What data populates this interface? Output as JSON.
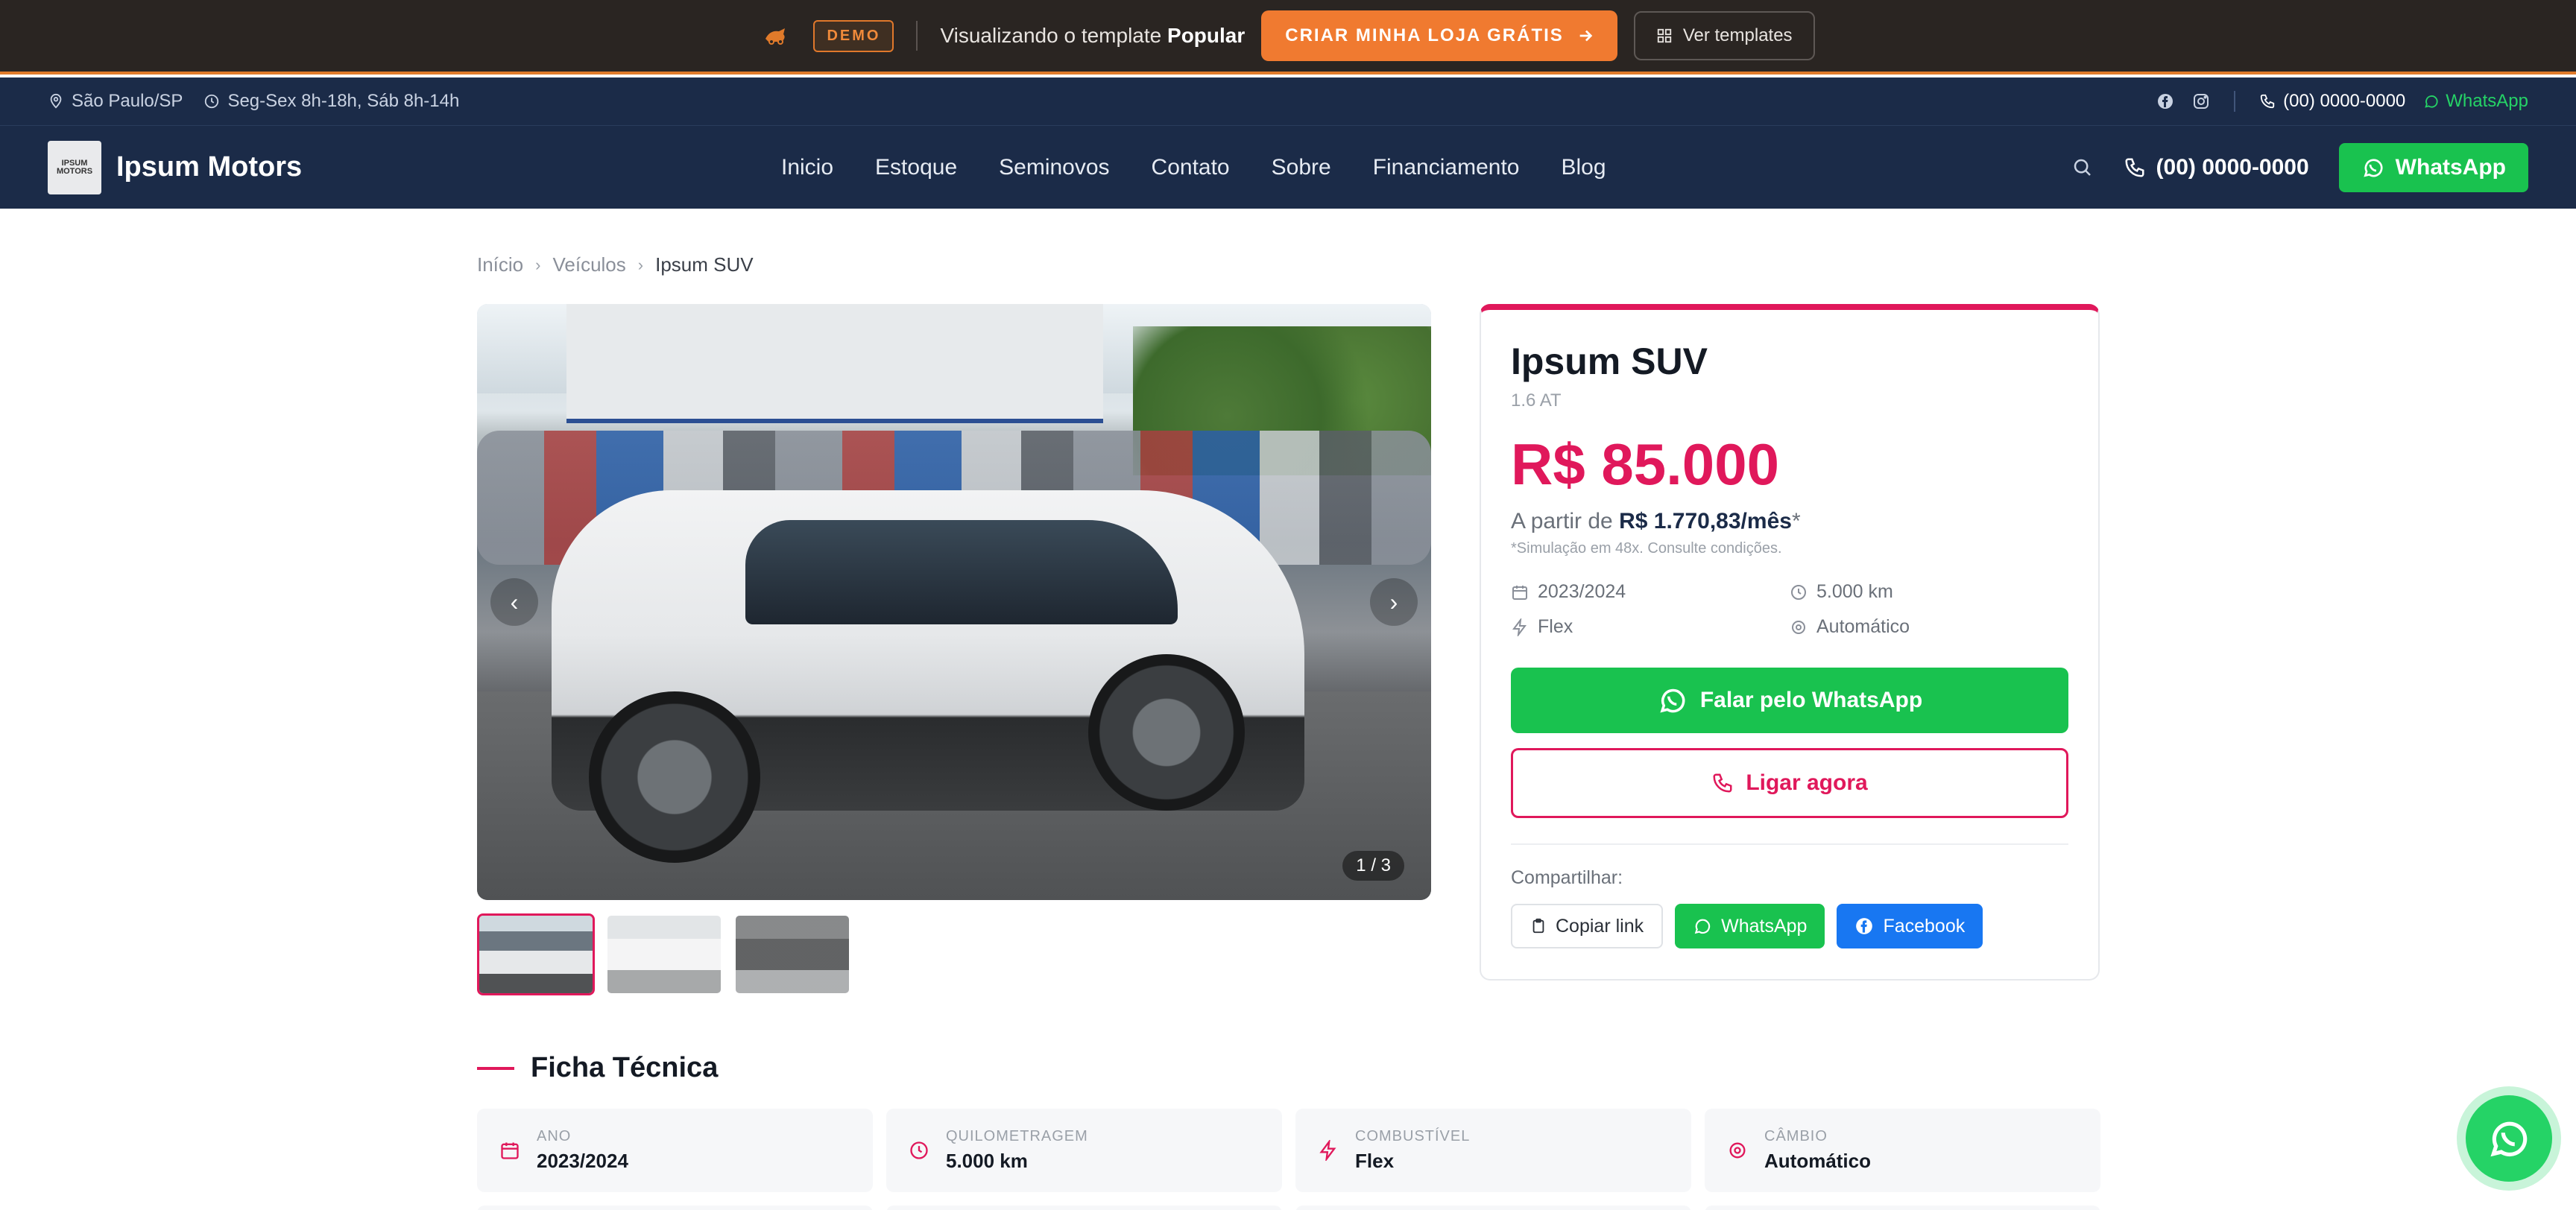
{
  "demo_bar": {
    "badge": "DEMO",
    "text_prefix": "Visualizando o template",
    "template_name": "Popular",
    "cta_label": "CRIAR MINHA LOJA GRÁTIS",
    "templates_label": "Ver templates",
    "accent_color": "#f07a30"
  },
  "info_bar": {
    "location": "São Paulo/SP",
    "hours": "Seg-Sex 8h-18h, Sáb 8h-14h",
    "phone": "(00) 0000-0000",
    "whatsapp": "WhatsApp",
    "social_icons": [
      "facebook-icon",
      "instagram-icon"
    ]
  },
  "nav": {
    "brand": "Ipsum Motors",
    "logo_text": "IPSUM MOTORS",
    "links": [
      "Inicio",
      "Estoque",
      "Seminovos",
      "Contato",
      "Sobre",
      "Financiamento",
      "Blog"
    ],
    "phone": "(00) 0000-0000",
    "whatsapp": "WhatsApp",
    "background_color": "#1b2b48"
  },
  "breadcrumb": [
    "Início",
    "Veículos",
    "Ipsum SUV"
  ],
  "gallery": {
    "counter": "1 / 3",
    "prev_icon": "chevron-left-icon",
    "next_icon": "chevron-right-icon",
    "thumbnail_count": 3,
    "active_thumbnail": 1
  },
  "card": {
    "title": "Ipsum SUV",
    "subtitle": "1.6 AT",
    "price": "R$ 85.000",
    "install_prefix": "A partir de",
    "install_value": "R$ 1.770,83/mês",
    "install_suffix": "*",
    "simulation_note": "*Simulação em 48x. Consulte condições.",
    "specs": {
      "year": "2023/2024",
      "mileage": "5.000 km",
      "fuel": "Flex",
      "transmission": "Automático"
    },
    "whatsapp_button": "Falar pelo WhatsApp",
    "call_button": "Ligar agora",
    "share_label": "Compartilhar:",
    "share_copy": "Copiar link",
    "share_whatsapp": "WhatsApp",
    "share_facebook": "Facebook",
    "accent_color": "#e0185b",
    "whatsapp_color": "#19c24f",
    "facebook_color": "#1877f2"
  },
  "ficha": {
    "title": "Ficha Técnica",
    "items": [
      {
        "label": "ANO",
        "value": "2023/2024",
        "icon": "calendar-icon"
      },
      {
        "label": "QUILOMETRAGEM",
        "value": "5.000 km",
        "icon": "gauge-icon"
      },
      {
        "label": "COMBUSTÍVEL",
        "value": "Flex",
        "icon": "fuel-icon"
      },
      {
        "label": "CÂMBIO",
        "value": "Automático",
        "icon": "gear-icon"
      }
    ]
  }
}
